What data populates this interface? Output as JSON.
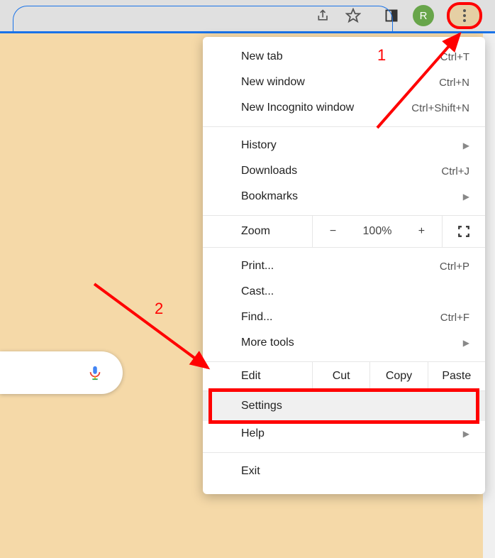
{
  "topbar": {
    "profile_letter": "R"
  },
  "search": {
    "mic_icon": "mic"
  },
  "menu": {
    "sec1": [
      {
        "label": "New tab",
        "short": "Ctrl+T"
      },
      {
        "label": "New window",
        "short": "Ctrl+N"
      },
      {
        "label": "New Incognito window",
        "short": "Ctrl+Shift+N"
      }
    ],
    "sec2": [
      {
        "label": "History",
        "sub": true
      },
      {
        "label": "Downloads",
        "short": "Ctrl+J"
      },
      {
        "label": "Bookmarks",
        "sub": true
      }
    ],
    "zoom": {
      "label": "Zoom",
      "minus": "−",
      "value": "100%",
      "plus": "+"
    },
    "sec3": [
      {
        "label": "Print...",
        "short": "Ctrl+P"
      },
      {
        "label": "Cast..."
      },
      {
        "label": "Find...",
        "short": "Ctrl+F"
      },
      {
        "label": "More tools",
        "sub": true
      }
    ],
    "edit": {
      "label": "Edit",
      "cut": "Cut",
      "copy": "Copy",
      "paste": "Paste"
    },
    "settings": {
      "label": "Settings"
    },
    "help": {
      "label": "Help",
      "sub": true
    },
    "exit": {
      "label": "Exit"
    }
  },
  "anno": {
    "one": "1",
    "two": "2"
  }
}
